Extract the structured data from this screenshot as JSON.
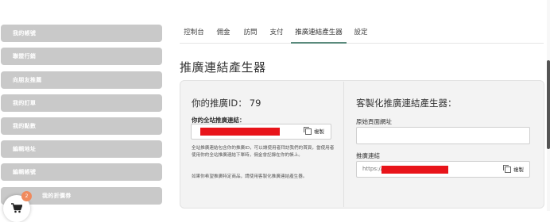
{
  "sidebar": {
    "items": [
      {
        "label": "我的帳號"
      },
      {
        "label": "聯盟行銷"
      },
      {
        "label": "向朋友推薦"
      },
      {
        "label": "我的訂單"
      },
      {
        "label": "我的點數"
      },
      {
        "label": "編輯地址"
      },
      {
        "label": "編輯帳號"
      },
      {
        "label": "我的折價券"
      }
    ],
    "cart": {
      "icon": "shopping-cart-icon",
      "badge": "2",
      "badge_color": "#f08a5d"
    }
  },
  "tabs": [
    {
      "label": "控制台"
    },
    {
      "label": "佣金"
    },
    {
      "label": "訪問"
    },
    {
      "label": "支付"
    },
    {
      "label": "推廣連結產生器",
      "active": true
    },
    {
      "label": "設定"
    }
  ],
  "page_title": "推廣連結產生器",
  "left": {
    "id_label": "你的推廣ID：",
    "id_value": "79",
    "link_label": "你的全站推廣連結：",
    "copy_label": "複製",
    "desc1": "全站推廣連結包含你的推廣ID，可以讓使用者拜訪我們的首頁，當使用者使用你的全站推廣連結下單時，佣金會記錄在你的帳上。",
    "desc2": "如果你希望推廣特定商品，請使用客製化推廣連結產生器。"
  },
  "right": {
    "title": "客製化推廣連結產生器：",
    "original_label": "原始頁面網址",
    "original_value": "",
    "generated_label": "推廣連結",
    "generated_prefix": "https://",
    "copy_label": "複製"
  },
  "colors": {
    "accent": "#5a8a7c",
    "sidebar_button": "#c9c9c9",
    "redaction": "#e8141a"
  }
}
